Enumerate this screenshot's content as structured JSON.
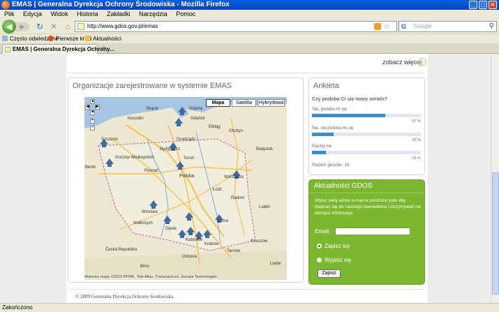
{
  "window": {
    "title": "EMAS | Generalna Dyrekcja Ochrony Środowiska - Mozilla Firefox",
    "min": "_",
    "max": "□",
    "close": "✕"
  },
  "menu": [
    "Plik",
    "Edycja",
    "Widok",
    "Historia",
    "Zakładki",
    "Narzędzia",
    "Pomoc"
  ],
  "nav": {
    "url": "http://www.gdos.gov.pl/emas",
    "search_placeholder": "Google",
    "back": "◀",
    "forward": "▶",
    "reload": "↻",
    "stop": "✕",
    "home": "⌂"
  },
  "bookmarks": [
    "Często odwiedzane",
    "Pierwsze kroki",
    "Aktualności"
  ],
  "tab": {
    "label": "EMAS | Generalna Dyrekcja Ochrony...",
    "new_tab": "+"
  },
  "page": {
    "more_link": "zobacz więcej",
    "map_panel": {
      "title": "Organizacje zarejestrowane w systemie EMAS",
      "map_types": [
        "Mapa",
        "Satelita",
        "Hybrydowa"
      ],
      "active_type": "Mapa",
      "cities": [
        "Gdynia",
        "Gdańsk",
        "Słupsk",
        "Koszalin",
        "Elbląg",
        "Olsztyn",
        "Szczecin",
        "Bydgoszcz",
        "Grudziądz",
        "Białystok",
        "Gorzów Wielkopolski",
        "Toruń",
        "Berlin",
        "Poznań",
        "Polska",
        "Warszawa",
        "Łódź",
        "Radom",
        "Lublin",
        "Wrocław",
        "Kielce",
        "Wałbrzych",
        "Opole",
        "Katowice",
        "Kraków",
        "Rzeszów",
        "Česká Republika",
        "Ostrava",
        "Tarnów",
        "Brno",
        "Lwów"
      ],
      "copyright": "Wartości mapy ©2010 PPWK, Tele Atlas, Transnavicom, Europa Technologies"
    },
    "poll": {
      "title": "Ankieta",
      "question": "Czy podoba Ci się nowy serwis?",
      "options": [
        {
          "label": "Tak, podoba mi się",
          "percent": 67,
          "percent_text": "67 %"
        },
        {
          "label": "Nie, nie podoba mi się",
          "percent": 20,
          "percent_text": "20 %"
        },
        {
          "label": "Raczej nie",
          "percent": 13,
          "percent_text": "13 %"
        }
      ],
      "total": "Razem głosów: 15"
    },
    "newsletter": {
      "title": "Aktualności GDOS",
      "description": "Wpisz swój adres e-mail w poniższe pole aby dopisać się do naszego newslettera i otrzymywać na bieżąco informacje",
      "email_label": "Email:",
      "email_value": "",
      "subscribe_label": "Zapisz się",
      "unsubscribe_label": "Wypisz się",
      "submit_label": "Zapisz",
      "selected": "subscribe"
    },
    "footer": "© 2009 Generalna Dyrekcja Ochrony Środowiska."
  },
  "status": "Zakończono",
  "colors": {
    "accent_green": "#7cb82f",
    "poll_bar": "#3b8fc8",
    "titlebar": "#0a5fe0"
  }
}
